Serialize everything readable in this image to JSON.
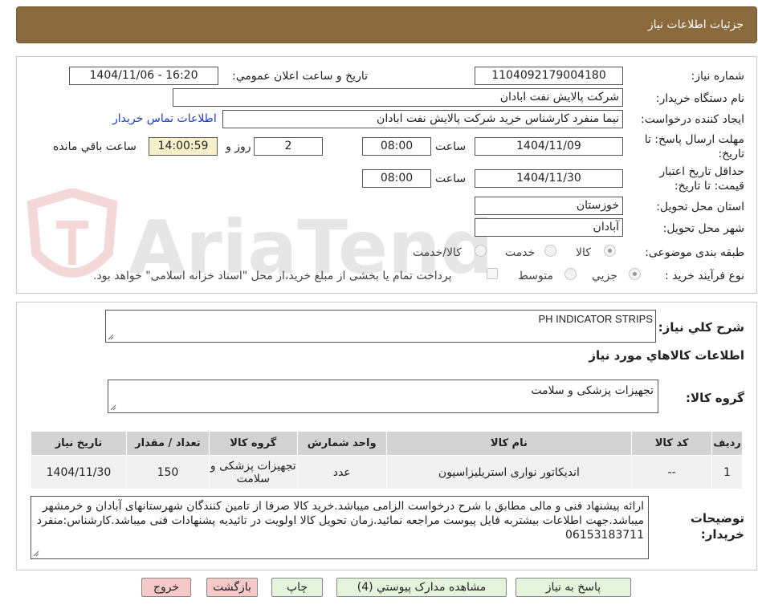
{
  "header": {
    "title": "جزئیات اطلاعات نیاز"
  },
  "watermark": {
    "text": "AriaTender.net"
  },
  "form": {
    "need_number": {
      "label": "شماره نیاز:",
      "value": "1104092179004180"
    },
    "announce_datetime": {
      "label": "تاریخ و ساعت اعلان عمومي:",
      "value": "1404/11/06 - 16:20"
    },
    "buyer_org": {
      "label": "نام دستگاه خريدار:",
      "value": "شرکت پالايش نفت ابادان"
    },
    "requester": {
      "label": "ايجاد کننده درخواست:",
      "value": "نیما منفرد کارشناس خرید شرکت پالايش نفت ابادان"
    },
    "buyer_contact_link": "اطلاعات تماس خريدار",
    "reply_deadline": {
      "label": "مهلت ارسال پاسخ: تا تاريخ:",
      "date": "1404/11/09",
      "time_label": "ساعت",
      "time": "08:00",
      "days": "2",
      "days_label": "روز و",
      "remaining": "14:00:59",
      "remaining_label": "ساعت باقي مانده"
    },
    "price_validity": {
      "label": "حداقل تاريخ اعتبار قيمت: تا تاريخ:",
      "date": "1404/11/30",
      "time_label": "ساعت",
      "time": "08:00"
    },
    "province": {
      "label": "استان محل تحويل:",
      "value": "خوزستان"
    },
    "city": {
      "label": "شهر محل تحويل:",
      "value": "آبادان"
    },
    "category": {
      "label": "طبقه بندی موضوعی:",
      "options": [
        "کالا",
        "خدمت",
        "کالا/خدمت"
      ],
      "selected": "کالا"
    },
    "purchase_process": {
      "label": "نوع فرآيند خريد :",
      "options": [
        "جزیي",
        "متوسط"
      ],
      "selected": "جزیي",
      "payment_note": "پرداخت تمام يا بخشی از مبلغ خريد،از محل \"اسناد خزانه اسلامی\" خواهد بود."
    }
  },
  "details": {
    "general_desc": {
      "label": "شرح کلي نياز:",
      "value": "PH INDICATOR STRIPS"
    },
    "items_heading": "اطلاعات کالاهاي مورد نياز",
    "goods_group": {
      "label": "گروه کالا:",
      "value": "تجهیزات پزشکی و سلامت"
    },
    "table": {
      "headers": [
        "رديف",
        "کد کالا",
        "نام کالا",
        "واحد شمارش",
        "گروه کالا",
        "تعداد / مقدار",
        "تاریخ نیاز"
      ],
      "rows": [
        [
          "1",
          "--",
          "اندیکاتور نواری استریلیزاسیون",
          "عدد",
          "تجهیزات پزشکی و سلامت",
          "150",
          "1404/11/30"
        ]
      ]
    },
    "buyer_notes": {
      "label": "توضيحات خريدار:",
      "value": "ارائه پیشنهاد فنی و مالی مطابق با شرح درخواست الزامی میباشد.خرید کالا صرفا از تامین کنندگان شهرستانهای آبادان و خرمشهر میباشد.جهت اطلاعات بیشتربه فایل پیوست مراجعه نمائید.زمان تحویل کالا اولویت در تائیدیه پشنهادات فنی میباشد.کارشناس:منفرد 06153183711"
    }
  },
  "buttons": {
    "reply": "پاسخ به نياز",
    "attachments": "مشاهده مدارک پيوستي (4)",
    "print": "چاپ",
    "back": "بازگشت",
    "exit": "خروج"
  }
}
